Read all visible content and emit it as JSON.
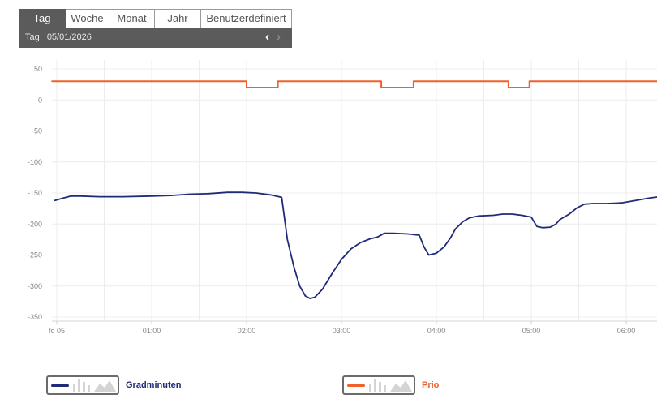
{
  "range_selector": {
    "tabs": [
      {
        "label": "Tag",
        "active": true
      },
      {
        "label": "Woche",
        "active": false
      },
      {
        "label": "Monat",
        "active": false
      },
      {
        "label": "Jahr",
        "active": false
      },
      {
        "label": "Benutzerdefiniert",
        "active": false
      }
    ],
    "period_label": "Tag",
    "date": "05/01/2026",
    "prev_icon": "chevron-left-icon",
    "next_icon": "chevron-right-icon"
  },
  "colors": {
    "series_1": "#1f2a78",
    "series_2": "#f0602b",
    "grid": "#ececec",
    "axis_text": "#888888",
    "panel": "#5b5b5b"
  },
  "chart_data": {
    "type": "line",
    "x_unit": "hours",
    "x_ticks": [
      {
        "x": 0,
        "label": "fo 05"
      },
      {
        "x": 1,
        "label": "01:00"
      },
      {
        "x": 2,
        "label": "02:00"
      },
      {
        "x": 3,
        "label": "03:00"
      },
      {
        "x": 4,
        "label": "04:00"
      },
      {
        "x": 5,
        "label": "05:00"
      },
      {
        "x": 6,
        "label": "06:00"
      }
    ],
    "xlim": [
      -0.05,
      6.35
    ],
    "ylim": [
      -350,
      50
    ],
    "y_ticks": [
      50,
      0,
      -50,
      -100,
      -150,
      -200,
      -250,
      -300,
      -350
    ],
    "grid": true,
    "legend_position": "bottom",
    "series": [
      {
        "name": "Gradminuten",
        "color": "#1f2a78",
        "points": [
          [
            -0.02,
            -162
          ],
          [
            0.05,
            -159
          ],
          [
            0.15,
            -155
          ],
          [
            0.25,
            -155
          ],
          [
            0.45,
            -156
          ],
          [
            0.7,
            -156
          ],
          [
            1.0,
            -155
          ],
          [
            1.2,
            -154
          ],
          [
            1.4,
            -152
          ],
          [
            1.6,
            -151
          ],
          [
            1.8,
            -149
          ],
          [
            1.95,
            -149
          ],
          [
            2.1,
            -150
          ],
          [
            2.25,
            -153
          ],
          [
            2.37,
            -157
          ],
          [
            2.43,
            -225
          ],
          [
            2.5,
            -270
          ],
          [
            2.56,
            -300
          ],
          [
            2.62,
            -316
          ],
          [
            2.67,
            -320
          ],
          [
            2.72,
            -318
          ],
          [
            2.8,
            -305
          ],
          [
            2.9,
            -280
          ],
          [
            3.0,
            -257
          ],
          [
            3.1,
            -240
          ],
          [
            3.2,
            -230
          ],
          [
            3.3,
            -224
          ],
          [
            3.38,
            -221
          ],
          [
            3.45,
            -215
          ],
          [
            3.55,
            -215
          ],
          [
            3.7,
            -216
          ],
          [
            3.82,
            -218
          ],
          [
            3.87,
            -237
          ],
          [
            3.92,
            -250
          ],
          [
            4.0,
            -247
          ],
          [
            4.08,
            -237
          ],
          [
            4.15,
            -222
          ],
          [
            4.2,
            -208
          ],
          [
            4.28,
            -196
          ],
          [
            4.35,
            -190
          ],
          [
            4.45,
            -187
          ],
          [
            4.6,
            -186
          ],
          [
            4.7,
            -184
          ],
          [
            4.8,
            -184
          ],
          [
            4.9,
            -186
          ],
          [
            5.0,
            -189
          ],
          [
            5.06,
            -204
          ],
          [
            5.12,
            -206
          ],
          [
            5.2,
            -205
          ],
          [
            5.26,
            -200
          ],
          [
            5.3,
            -193
          ],
          [
            5.4,
            -184
          ],
          [
            5.48,
            -174
          ],
          [
            5.56,
            -168
          ],
          [
            5.65,
            -167
          ],
          [
            5.8,
            -167
          ],
          [
            5.95,
            -166
          ],
          [
            6.1,
            -162
          ],
          [
            6.25,
            -158
          ],
          [
            6.35,
            -156
          ]
        ]
      },
      {
        "name": "Prio",
        "color": "#f0602b",
        "step": true,
        "points": [
          [
            -0.05,
            30
          ],
          [
            2.0,
            30
          ],
          [
            2.0,
            20
          ],
          [
            2.33,
            20
          ],
          [
            2.33,
            30
          ],
          [
            3.42,
            30
          ],
          [
            3.42,
            20
          ],
          [
            3.76,
            20
          ],
          [
            3.76,
            30
          ],
          [
            4.76,
            30
          ],
          [
            4.76,
            20
          ],
          [
            4.98,
            20
          ],
          [
            4.98,
            30
          ],
          [
            6.35,
            30
          ]
        ]
      }
    ]
  }
}
